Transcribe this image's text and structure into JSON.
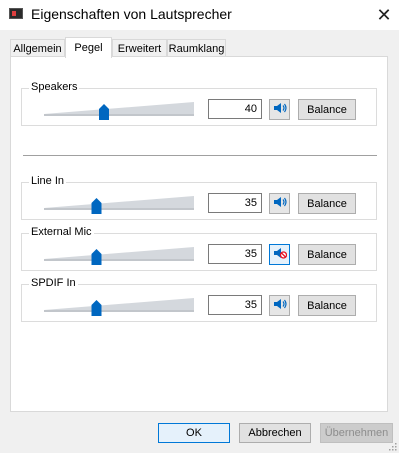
{
  "window": {
    "title": "Eigenschaften von Lautsprecher",
    "close_glyph": "✕"
  },
  "tabs": [
    {
      "label": "Allgemein",
      "active": false
    },
    {
      "label": "Pegel",
      "active": true
    },
    {
      "label": "Erweitert",
      "active": false
    },
    {
      "label": "Raumklang",
      "active": false
    }
  ],
  "channels": [
    {
      "label": "Speakers",
      "value": "40",
      "level_fraction": 0.4,
      "muted": false,
      "speaker_icon": "speaker-icon",
      "balance_label": "Balance"
    },
    {
      "label": "Line In",
      "value": "35",
      "level_fraction": 0.35,
      "muted": false,
      "speaker_icon": "speaker-icon",
      "balance_label": "Balance"
    },
    {
      "label": "External Mic",
      "value": "35",
      "level_fraction": 0.35,
      "muted": true,
      "speaker_icon": "speaker-muted-icon",
      "balance_label": "Balance"
    },
    {
      "label": "SPDIF In",
      "value": "35",
      "level_fraction": 0.35,
      "muted": false,
      "speaker_icon": "speaker-icon",
      "balance_label": "Balance"
    }
  ],
  "footer": {
    "ok_label": "OK",
    "cancel_label": "Abbrechen",
    "apply_label": "Übernehmen"
  },
  "colors": {
    "accent": "#0078d7",
    "thumb": "#0067c0",
    "track": "#d4d8dd",
    "mute": "#e81123"
  }
}
